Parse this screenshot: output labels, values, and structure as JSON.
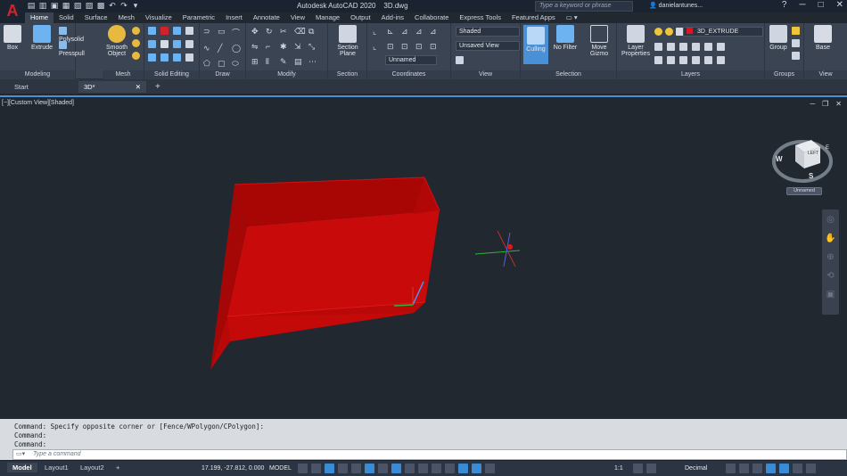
{
  "app": {
    "logo": "A",
    "title": "Autodesk AutoCAD 2020",
    "document": "3D.dwg",
    "search_placeholder": "Type a keyword or phrase",
    "user": "danielantunes..."
  },
  "ribbon_tabs": [
    "Home",
    "Solid",
    "Surface",
    "Mesh",
    "Visualize",
    "Parametric",
    "Insert",
    "Annotate",
    "View",
    "Manage",
    "Output",
    "Add-ins",
    "Collaborate",
    "Express Tools",
    "Featured Apps"
  ],
  "ribbon": {
    "modeling": {
      "title": "Modeling",
      "box": "Box",
      "extrude": "Extrude",
      "polysolid": "Polysolid",
      "presspull": "Presspull"
    },
    "mesh": {
      "title": "Mesh",
      "smooth_object_1": "Smooth",
      "smooth_object_2": "Object"
    },
    "solid_editing": {
      "title": "Solid Editing"
    },
    "draw": {
      "title": "Draw"
    },
    "modify": {
      "title": "Modify"
    },
    "section": {
      "title": "Section",
      "section_plane_1": "Section",
      "section_plane_2": "Plane"
    },
    "coordinates": {
      "title": "Coordinates",
      "ucs_dropdown": "Unnamed"
    },
    "view": {
      "title": "View",
      "visual_style": "Shaded",
      "saved_view": "Unsaved View"
    },
    "selection": {
      "title": "Selection",
      "culling": "Culling",
      "no_filter_1": "No Filter",
      "move_gizmo_1": "Move",
      "move_gizmo_2": "Gizmo"
    },
    "layers": {
      "title": "Layers",
      "layer_properties_1": "Layer",
      "layer_properties_2": "Properties",
      "current_layer": "3D_EXTRUDE",
      "layer_color": "#e0141e"
    },
    "groups": {
      "title": "Groups",
      "group": "Group"
    },
    "view2": {
      "title": "View",
      "base": "Base"
    }
  },
  "doc_tabs": [
    {
      "label": "Start"
    },
    {
      "label": "3D*"
    }
  ],
  "viewport": {
    "label": "[−][Custom View][Shaded]",
    "viewcube_face": "LEFT",
    "viewcube_top": "TOP",
    "compass": {
      "w": "W",
      "s": "S",
      "e": "E"
    },
    "ucs_label": "Unnamed",
    "object_color": "#c80a0a"
  },
  "command": {
    "history": [
      "Command: Specify opposite corner or [Fence/WPolygon/CPolygon]:",
      "Command:",
      "Command:"
    ],
    "placeholder": "Type a command"
  },
  "status": {
    "tabs": [
      "Model",
      "Layout1",
      "Layout2"
    ],
    "coords": "17.199, -27.812, 0.000",
    "model_label": "MODEL",
    "scale": "1:1",
    "units": "Decimal"
  }
}
